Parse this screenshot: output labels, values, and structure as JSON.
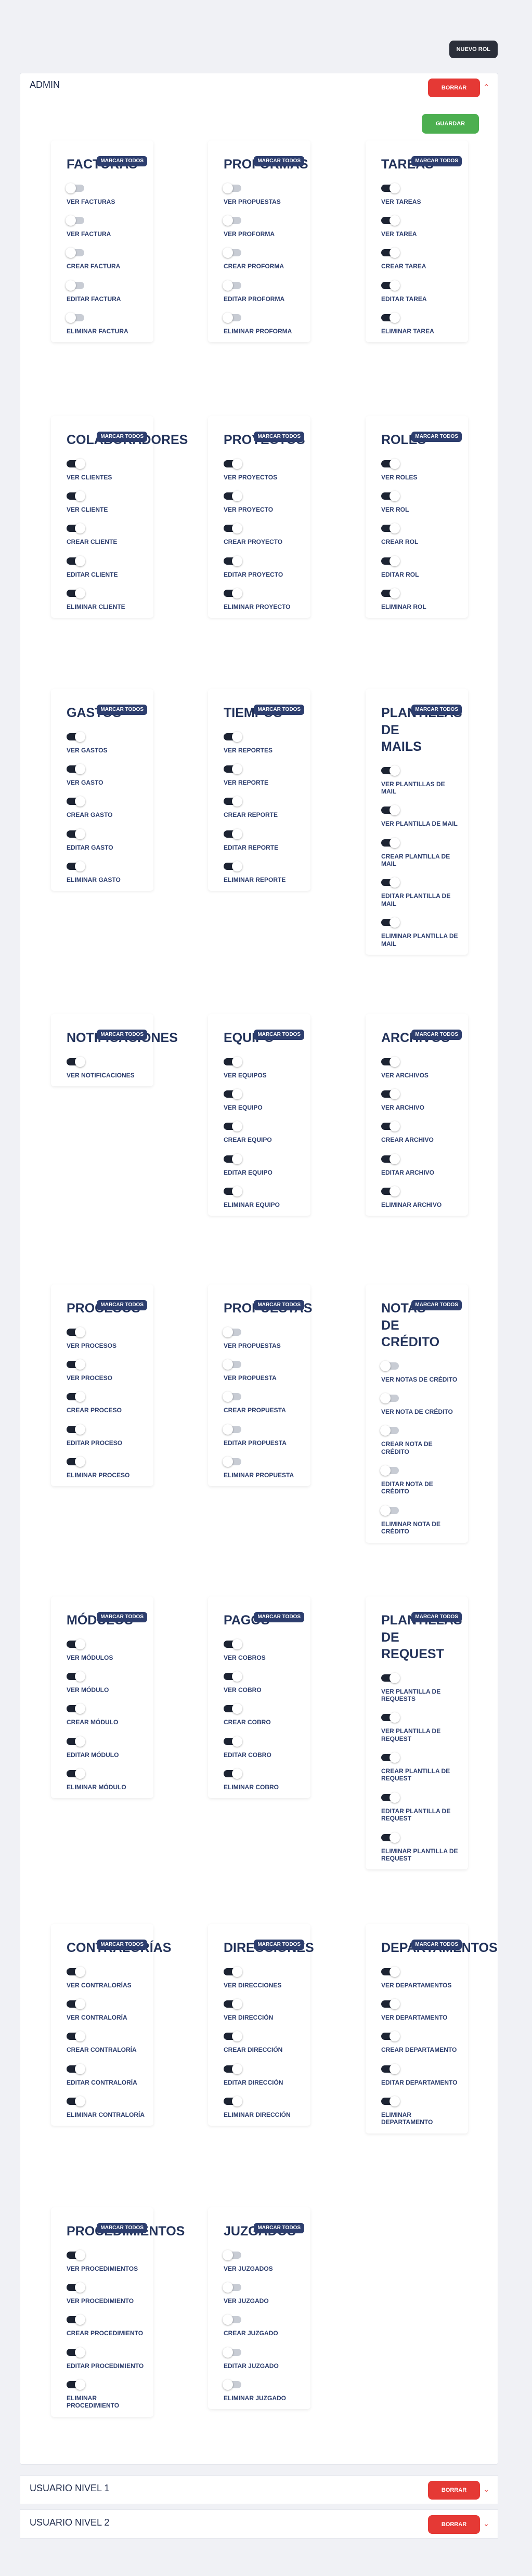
{
  "header": {
    "new_role": "NUEVO ROL"
  },
  "admin": {
    "title": "ADMIN",
    "delete": "BORRAR",
    "save": "GUARDAR",
    "mark_all": "MARCAR TODOS"
  },
  "groups": [
    {
      "title": "FACTURAS",
      "perms": [
        {
          "label": "VER FACTURAS",
          "on": false
        },
        {
          "label": "VER FACTURA",
          "on": false
        },
        {
          "label": "CREAR FACTURA",
          "on": false
        },
        {
          "label": "EDITAR FACTURA",
          "on": false
        },
        {
          "label": "ELIMINAR FACTURA",
          "on": false
        }
      ]
    },
    {
      "title": "PROFORMAS",
      "perms": [
        {
          "label": "VER PROPUESTAS",
          "on": false
        },
        {
          "label": "VER PROFORMA",
          "on": false
        },
        {
          "label": "CREAR PROFORMA",
          "on": false
        },
        {
          "label": "EDITAR PROFORMA",
          "on": false
        },
        {
          "label": "ELIMINAR PROFORMA",
          "on": false
        }
      ]
    },
    {
      "title": "TAREAS",
      "perms": [
        {
          "label": "VER TAREAS",
          "on": true
        },
        {
          "label": "VER TAREA",
          "on": true
        },
        {
          "label": "CREAR TAREA",
          "on": true
        },
        {
          "label": "EDITAR TAREA",
          "on": true
        },
        {
          "label": "ELIMINAR TAREA",
          "on": true
        }
      ]
    },
    {
      "title": "COLABORADORES",
      "perms": [
        {
          "label": "VER CLIENTES",
          "on": true
        },
        {
          "label": "VER CLIENTE",
          "on": true
        },
        {
          "label": "CREAR CLIENTE",
          "on": true
        },
        {
          "label": "EDITAR CLIENTE",
          "on": true
        },
        {
          "label": "ELIMINAR CLIENTE",
          "on": true
        }
      ]
    },
    {
      "title": "PROYECTOS",
      "perms": [
        {
          "label": "VER PROYECTOS",
          "on": true
        },
        {
          "label": "VER PROYECTO",
          "on": true
        },
        {
          "label": "CREAR PROYECTO",
          "on": true
        },
        {
          "label": "EDITAR PROYECTO",
          "on": true
        },
        {
          "label": "ELIMINAR PROYECTO",
          "on": true
        }
      ]
    },
    {
      "title": "ROLES",
      "perms": [
        {
          "label": "VER ROLES",
          "on": true
        },
        {
          "label": "VER ROL",
          "on": true
        },
        {
          "label": "CREAR ROL",
          "on": true
        },
        {
          "label": "EDITAR ROL",
          "on": true
        },
        {
          "label": "ELIMINAR ROL",
          "on": true
        }
      ]
    },
    {
      "title": "GASTOS",
      "perms": [
        {
          "label": "VER GASTOS",
          "on": true
        },
        {
          "label": "VER GASTO",
          "on": true
        },
        {
          "label": "CREAR GASTO",
          "on": true
        },
        {
          "label": "EDITAR GASTO",
          "on": true
        },
        {
          "label": "ELIMINAR GASTO",
          "on": true
        }
      ]
    },
    {
      "title": "TIEMPOS",
      "perms": [
        {
          "label": "VER REPORTES",
          "on": true
        },
        {
          "label": "VER REPORTE",
          "on": true
        },
        {
          "label": "CREAR REPORTE",
          "on": true
        },
        {
          "label": "EDITAR REPORTE",
          "on": true
        },
        {
          "label": "ELIMINAR REPORTE",
          "on": true
        }
      ]
    },
    {
      "title": "PLANTILLAS DE MAILS",
      "perms": [
        {
          "label": "VER PLANTILLAS DE MAIL",
          "on": true
        },
        {
          "label": "VER PLANTILLA DE MAIL",
          "on": true
        },
        {
          "label": "CREAR PLANTILLA DE MAIL",
          "on": true
        },
        {
          "label": "EDITAR PLANTILLA DE MAIL",
          "on": true
        },
        {
          "label": "ELIMINAR PLANTILLA DE MAIL",
          "on": true
        }
      ]
    },
    {
      "title": "NOTIFICACIONES",
      "perms": [
        {
          "label": "VER NOTIFICACIONES",
          "on": true
        }
      ]
    },
    {
      "title": "EQUIPO",
      "perms": [
        {
          "label": "VER EQUIPOS",
          "on": true
        },
        {
          "label": "VER EQUIPO",
          "on": true
        },
        {
          "label": "CREAR EQUIPO",
          "on": true
        },
        {
          "label": "EDITAR EQUIPO",
          "on": true
        },
        {
          "label": "ELIMINAR EQUIPO",
          "on": true
        }
      ]
    },
    {
      "title": "ARCHIVOS",
      "perms": [
        {
          "label": "VER ARCHIVOS",
          "on": true
        },
        {
          "label": "VER ARCHIVO",
          "on": true
        },
        {
          "label": "CREAR ARCHIVO",
          "on": true
        },
        {
          "label": "EDITAR ARCHIVO",
          "on": true
        },
        {
          "label": "ELIMINAR ARCHIVO",
          "on": true
        }
      ]
    },
    {
      "title": "PROCESOS",
      "perms": [
        {
          "label": "VER PROCESOS",
          "on": true
        },
        {
          "label": "VER PROCESO",
          "on": true
        },
        {
          "label": "CREAR PROCESO",
          "on": true
        },
        {
          "label": "EDITAR PROCESO",
          "on": true
        },
        {
          "label": "ELIMINAR PROCESO",
          "on": true
        }
      ]
    },
    {
      "title": "PROPUESTAS",
      "perms": [
        {
          "label": "VER PROPUESTAS",
          "on": false
        },
        {
          "label": "VER PROPUESTA",
          "on": false
        },
        {
          "label": "CREAR PROPUESTA",
          "on": false
        },
        {
          "label": "EDITAR PROPUESTA",
          "on": false
        },
        {
          "label": "ELIMINAR PROPUESTA",
          "on": false
        }
      ]
    },
    {
      "title": "NOTAS DE CRÉDITO",
      "perms": [
        {
          "label": "VER NOTAS DE CRÉDITO",
          "on": false
        },
        {
          "label": "VER NOTA DE CRÉDITO",
          "on": false
        },
        {
          "label": "CREAR NOTA DE CRÉDITO",
          "on": false
        },
        {
          "label": "EDITAR NOTA DE CRÉDITO",
          "on": false
        },
        {
          "label": "ELIMINAR NOTA DE CRÉDITO",
          "on": false
        }
      ]
    },
    {
      "title": "MÓDULOS",
      "perms": [
        {
          "label": "VER MÓDULOS",
          "on": true
        },
        {
          "label": "VER MÓDULO",
          "on": true
        },
        {
          "label": "CREAR MÓDULO",
          "on": true
        },
        {
          "label": "EDITAR MÓDULO",
          "on": true
        },
        {
          "label": "ELIMINAR MÓDULO",
          "on": true
        }
      ]
    },
    {
      "title": "PAGOS",
      "perms": [
        {
          "label": "VER COBROS",
          "on": true
        },
        {
          "label": "VER COBRO",
          "on": true
        },
        {
          "label": "CREAR COBRO",
          "on": true
        },
        {
          "label": "EDITAR COBRO",
          "on": true
        },
        {
          "label": "ELIMINAR COBRO",
          "on": true
        }
      ]
    },
    {
      "title": "PLANTILLAS DE REQUEST",
      "perms": [
        {
          "label": "VER PLANTILLA DE REQUESTS",
          "on": true
        },
        {
          "label": "VER PLANTILLA DE REQUEST",
          "on": true
        },
        {
          "label": "CREAR PLANTILLA DE REQUEST",
          "on": true
        },
        {
          "label": "EDITAR PLANTILLA DE REQUEST",
          "on": true
        },
        {
          "label": "ELIMINAR PLANTILLA DE REQUEST",
          "on": true
        }
      ]
    },
    {
      "title": "CONTRALORÍAS",
      "perms": [
        {
          "label": "VER CONTRALORÍAS",
          "on": true
        },
        {
          "label": "VER CONTRALORÍA",
          "on": true
        },
        {
          "label": "CREAR CONTRALORÍA",
          "on": true
        },
        {
          "label": "EDITAR CONTRALORÍA",
          "on": true
        },
        {
          "label": "ELIMINAR CONTRALORÍA",
          "on": true
        }
      ]
    },
    {
      "title": "DIRECCIONES",
      "perms": [
        {
          "label": "VER DIRECCIONES",
          "on": true
        },
        {
          "label": "VER DIRECCIÓN",
          "on": true
        },
        {
          "label": "CREAR DIRECCIÓN",
          "on": true
        },
        {
          "label": "EDITAR DIRECCIÓN",
          "on": true
        },
        {
          "label": "ELIMINAR DIRECCIÓN",
          "on": true
        }
      ]
    },
    {
      "title": "DEPARTAMENTOS",
      "perms": [
        {
          "label": "VER DEPARTAMENTOS",
          "on": true
        },
        {
          "label": "VER DEPARTAMENTO",
          "on": true
        },
        {
          "label": "CREAR DEPARTAMENTO",
          "on": true
        },
        {
          "label": "EDITAR DEPARTAMENTO",
          "on": true
        },
        {
          "label": "ELIMINAR DEPARTAMENTO",
          "on": true
        }
      ]
    },
    {
      "title": "PROCEDIMIENTOS",
      "perms": [
        {
          "label": "VER PROCEDIMIENTOS",
          "on": true
        },
        {
          "label": "VER PROCEDIMIENTO",
          "on": true
        },
        {
          "label": "CREAR PROCEDIMIENTO",
          "on": true
        },
        {
          "label": "EDITAR PROCEDIMIENTO",
          "on": true
        },
        {
          "label": "ELIMINAR PROCEDIMIENTO",
          "on": true
        }
      ]
    },
    {
      "title": "JUZGADOS",
      "perms": [
        {
          "label": "VER JUZGADOS",
          "on": false
        },
        {
          "label": "VER JUZGADO",
          "on": false
        },
        {
          "label": "CREAR JUZGADO",
          "on": false
        },
        {
          "label": "EDITAR JUZGADO",
          "on": false
        },
        {
          "label": "ELIMINAR JUZGADO",
          "on": false
        }
      ]
    }
  ],
  "other_roles": [
    {
      "title": "USUARIO NIVEL 1",
      "delete": "BORRAR"
    },
    {
      "title": "USUARIO NIVEL 2",
      "delete": "BORRAR"
    }
  ]
}
